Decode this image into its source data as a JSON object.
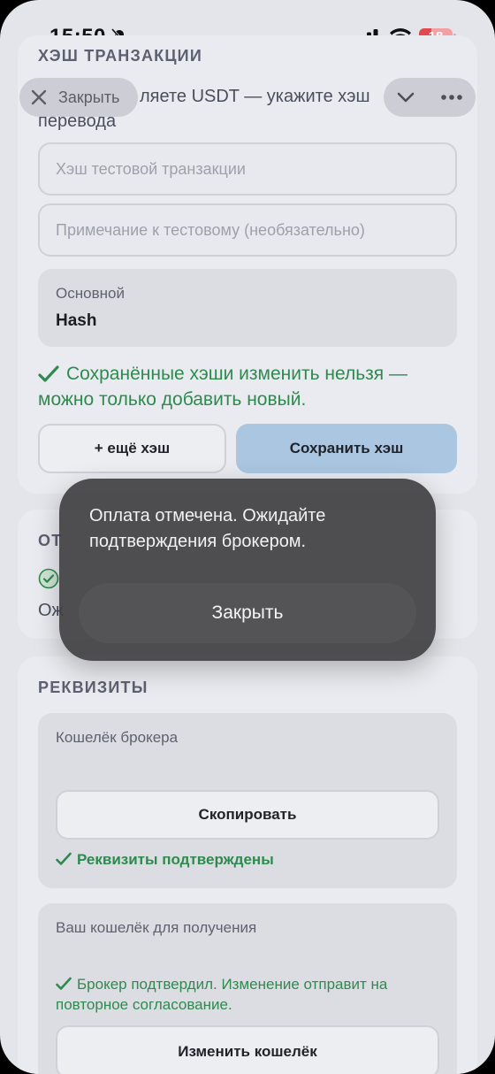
{
  "status_bar": {
    "time": "15:50",
    "battery": "18"
  },
  "top_bar": {
    "close_label": "Закрыть"
  },
  "hash_section": {
    "title": "ХЭШ ТРАНЗАКЦИИ",
    "description_visible": "ляете USDT — укажите хэш",
    "description_line2": "перевода",
    "hash_placeholder": "Хэш тестовой транзакции",
    "note_placeholder": "Примечание к тестовому (необязательно)",
    "saved": {
      "label": "Основной",
      "value": "Hash"
    },
    "notice_line1": "Сохранённые хэши изменить нельзя —",
    "notice_line2": "можно только добавить новый.",
    "add_button": "+ ещё хэш",
    "save_button": "Сохранить хэш"
  },
  "payment_section": {
    "title_partial": "ОТ",
    "text_partial": "Ож"
  },
  "toast": {
    "message": "Оплата отмечена. Ожидайте подтверждения брокером.",
    "close_button": "Закрыть"
  },
  "requisites": {
    "title": "РЕКВИЗИТЫ",
    "broker_wallet": {
      "label": "Кошелёк брокера",
      "copy_button": "Скопировать",
      "status": "Реквизиты подтверждены"
    },
    "your_wallet": {
      "label": "Ваш кошелёк для получения",
      "status_line1": "Брокер подтвердил. Изменение отправит на",
      "status_line2": "повторное согласование.",
      "change_button": "Изменить кошелёк"
    }
  },
  "colors": {
    "accent": "#aac6e0",
    "success": "#2e8a4e",
    "background": "#e4e5ea"
  }
}
